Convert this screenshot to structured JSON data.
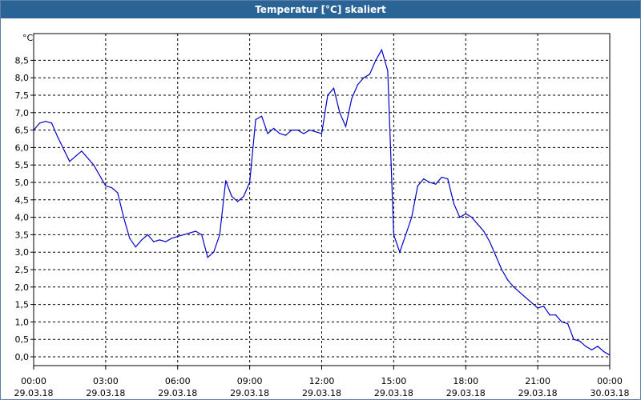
{
  "window": {
    "title": "Temperatur [°C] skaliert"
  },
  "chart_data": {
    "type": "line",
    "title": "Temperatur [°C] skaliert",
    "ylabel": "°C",
    "xlabel": "",
    "ylim": [
      -0.2,
      9.0
    ],
    "xlim": [
      0,
      24
    ],
    "grid": true,
    "y_ticks": [
      "0,0",
      "0,5",
      "1,0",
      "1,5",
      "2,0",
      "2,5",
      "3,0",
      "3,5",
      "4,0",
      "4,5",
      "5,0",
      "5,5",
      "6,0",
      "6,5",
      "7,0",
      "7,5",
      "8,0",
      "8,5"
    ],
    "x_ticks": [
      {
        "time": "00:00",
        "date": "29.03.18"
      },
      {
        "time": "03:00",
        "date": "29.03.18"
      },
      {
        "time": "06:00",
        "date": "29.03.18"
      },
      {
        "time": "09:00",
        "date": "29.03.18"
      },
      {
        "time": "12:00",
        "date": "29.03.18"
      },
      {
        "time": "15:00",
        "date": "29.03.18"
      },
      {
        "time": "18:00",
        "date": "29.03.18"
      },
      {
        "time": "21:00",
        "date": "29.03.18"
      },
      {
        "time": "00:00",
        "date": "30.03.18"
      }
    ],
    "line_color": "#0000cc",
    "series": [
      {
        "x": [
          0.0,
          0.25,
          0.5,
          0.75,
          1.0,
          1.5,
          2.0,
          2.5,
          3.0,
          3.25,
          3.5,
          3.75,
          4.0,
          4.25,
          4.5,
          4.75,
          5.0,
          5.25,
          5.5,
          5.75,
          6.0,
          6.25,
          6.5,
          6.75,
          7.0,
          7.25,
          7.5,
          7.75,
          8.0,
          8.25,
          8.5,
          8.75,
          9.0,
          9.25,
          9.5,
          9.75,
          10.0,
          10.25,
          10.5,
          10.75,
          11.0,
          11.25,
          11.5,
          11.75,
          12.0,
          12.25,
          12.5,
          12.75,
          13.0,
          13.25,
          13.5,
          13.75,
          14.0,
          14.25,
          14.5,
          14.75,
          15.0,
          15.25,
          15.5,
          15.75,
          16.0,
          16.25,
          16.5,
          16.75,
          17.0,
          17.25,
          17.5,
          17.75,
          18.0,
          18.25,
          18.5,
          18.75,
          19.0,
          19.25,
          19.5,
          19.75,
          20.0,
          20.5,
          21.0,
          21.25,
          21.5,
          21.75,
          22.0,
          22.25,
          22.5,
          22.75,
          23.0,
          23.25,
          23.5,
          23.75,
          24.0
        ],
        "y": [
          6.5,
          6.7,
          6.75,
          6.7,
          6.3,
          5.6,
          5.9,
          5.5,
          4.9,
          4.85,
          4.7,
          4.0,
          3.4,
          3.15,
          3.35,
          3.5,
          3.3,
          3.35,
          3.3,
          3.4,
          3.45,
          3.5,
          3.55,
          3.6,
          3.5,
          2.85,
          3.0,
          3.5,
          5.05,
          4.6,
          4.45,
          4.6,
          5.0,
          6.8,
          6.9,
          6.4,
          6.55,
          6.4,
          6.35,
          6.5,
          6.5,
          6.4,
          6.5,
          6.45,
          6.4,
          7.5,
          7.7,
          7.0,
          6.6,
          7.4,
          7.8,
          8.0,
          8.1,
          8.5,
          8.8,
          8.2,
          3.5,
          3.0,
          3.5,
          4.0,
          4.9,
          5.1,
          5.0,
          4.95,
          5.15,
          5.1,
          4.4,
          4.0,
          4.1,
          4.0,
          3.8,
          3.6,
          3.3,
          2.9,
          2.5,
          2.2,
          2.0,
          1.7,
          1.4,
          1.45,
          1.2,
          1.2,
          1.0,
          0.95,
          0.5,
          0.45,
          0.3,
          0.2,
          0.3,
          0.15,
          0.05
        ]
      }
    ]
  }
}
